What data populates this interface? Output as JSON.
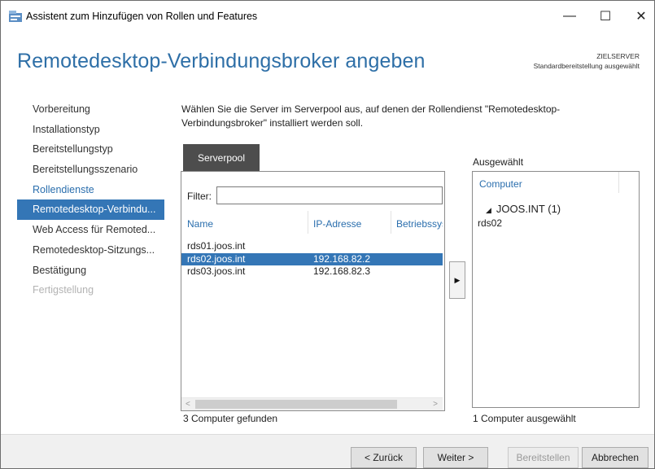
{
  "window": {
    "title": "Assistent zum Hinzufügen von Rollen und Features",
    "minimize_glyph": "—",
    "maximize_glyph": "☐",
    "close_glyph": "✕",
    "app_icon": "server-manager-icon"
  },
  "header": {
    "title": "Remotedesktop-Verbindungsbroker angeben",
    "target_label": "ZIELSERVER",
    "target_value": "Standardbereitstellung ausgewählt"
  },
  "nav": {
    "items": [
      {
        "label": "Vorbereitung",
        "state": "normal"
      },
      {
        "label": "Installationstyp",
        "state": "normal"
      },
      {
        "label": "Bereitstellungstyp",
        "state": "normal"
      },
      {
        "label": "Bereitstellungsszenario",
        "state": "normal"
      },
      {
        "label": "Rollendienste",
        "state": "link"
      },
      {
        "label": "Remotedesktop-Verbindu...",
        "state": "active"
      },
      {
        "label": "Web Access für Remoted...",
        "state": "normal"
      },
      {
        "label": "Remotedesktop-Sitzungs...",
        "state": "normal"
      },
      {
        "label": "Bestätigung",
        "state": "normal"
      },
      {
        "label": "Fertigstellung",
        "state": "disabled"
      }
    ]
  },
  "content": {
    "instruction": "Wählen Sie die Server im Serverpool aus, auf denen der Rollendienst \"Remotedesktop-Verbindungsbroker\" installiert werden soll."
  },
  "pool": {
    "tab_label": "Serverpool",
    "filter_label": "Filter:",
    "filter_value": "",
    "columns": [
      "Name",
      "IP-Adresse",
      "Betriebssystem"
    ],
    "rows": [
      {
        "name": "rds01.joos.int",
        "ip": ""
      },
      {
        "name": "rds02.joos.int",
        "ip": "192.168.82.2"
      },
      {
        "name": "rds03.joos.int",
        "ip": "192.168.82.3"
      }
    ],
    "selected_row": 1,
    "status": "3 Computer gefunden",
    "scroll_left": "<",
    "scroll_right": ">"
  },
  "add_button": {
    "glyph": "▶",
    "icon": "arrow-right-icon"
  },
  "selected": {
    "label": "Ausgewählt",
    "column": "Computer",
    "group_glyph": "◢",
    "group": "JOOS.INT (1)",
    "items": [
      "rds02"
    ],
    "status": "1 Computer ausgewählt"
  },
  "footer": {
    "back": "< Zurück",
    "next": "Weiter >",
    "deploy": "Bereitstellen",
    "cancel": "Abbrechen"
  },
  "colors": {
    "accent": "#3476b6",
    "title_blue": "#2e6fa7",
    "tab_dark": "#4d4d4d"
  }
}
